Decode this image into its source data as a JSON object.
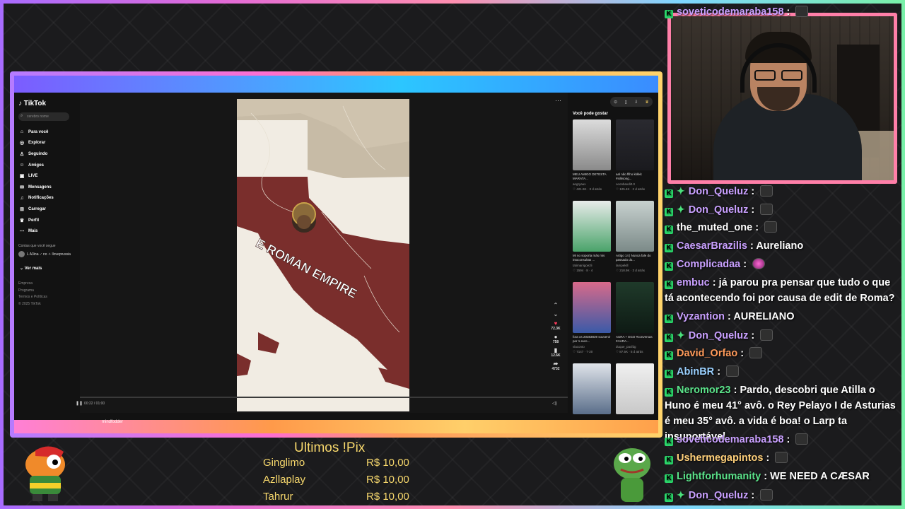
{
  "browser": {
    "tiktok": {
      "logo": "TikTok",
      "search_placeholder": "cerebro nome",
      "nav": [
        "Para você",
        "Explorar",
        "Seguindo",
        "Amigos",
        "LIVE",
        "Mensagens",
        "Notificações",
        "Carregar",
        "Perfil",
        "Mais"
      ],
      "following_title": "Contas que você segue",
      "following_user": "L A3ina ♂ no ✧ lloveprussia",
      "see_more": "Ver mais",
      "footer": [
        "Empresa",
        "Programa",
        "Termos e Políticas",
        "© 2025 TikTok"
      ],
      "video_text": "E ROMAN EMPIRE",
      "likes": "72.3K",
      "comments": "758",
      "saves": "12.6K",
      "shares": "4732",
      "time": "00:22 / 01:00",
      "bottom_user": "mindfodder",
      "suggestions_title": "Você pode gostar",
      "suggestions": [
        {
          "caption": "MEU AMIGO DETESTA MARATA...",
          "user": "angryaux",
          "meta": "♡ 421.9K · 3 d atrás"
        },
        {
          "caption": "aal não fllho kkkkk #silksong...",
          "user": "ooonbaxdi0.0",
          "meta": "♡ 125.4K · 2 d atrás"
        },
        {
          "caption": "Mi no soporta más mis intoconsultas ...",
          "user": "tatimanigoezli",
          "meta": "♡ 1594 · 8 · 4"
        },
        {
          "caption": "Artigo 14 | Nunca fale do passado do...",
          "user": "lampekill",
          "meta": "♡ 218.9K · 3 d atrás"
        },
        {
          "caption": "fora os 20383839 souvenir por 1 euro...",
          "user": "viaconto",
          "meta": "♡ 7147 · 7·20"
        },
        {
          "caption": "AURA + EGO #conversas #AURA...",
          "user": "duque_pacfdg",
          "meta": "♡ 87.5K · 5 d atrás"
        },
        {
          "caption": "",
          "user": "",
          "meta": ""
        },
        {
          "caption": "",
          "user": "",
          "meta": ""
        }
      ]
    }
  },
  "chat": [
    {
      "user": "soveticodemaraba158",
      "color": "#c9a0ff",
      "msg": "",
      "emote": true,
      "badges": [
        "k"
      ]
    },
    {
      "user": "Don_Queluz",
      "color": "#c9a0ff",
      "msg": "",
      "emote": true,
      "badges": [
        "k",
        "d"
      ]
    },
    {
      "user": "Don_Queluz",
      "color": "#c9a0ff",
      "msg": "",
      "emote": true,
      "badges": [
        "k",
        "d"
      ]
    },
    {
      "user": "the_muted_one",
      "color": "#ffffff",
      "msg": "",
      "emote": true,
      "badges": [
        "k"
      ]
    },
    {
      "user": "CaesarBrazilis",
      "color": "#c9a0ff",
      "msg": "Aureliano",
      "emote": false,
      "badges": [
        "k"
      ]
    },
    {
      "user": "Complicadaa",
      "color": "#c9a0ff",
      "msg": "",
      "emote": true,
      "emote_pink": true,
      "badges": [
        "k"
      ]
    },
    {
      "user": "embuc",
      "color": "#c9a0ff",
      "msg": "já parou pra pensar que tudo o que tá acontecendo foi por causa de edit de Roma?",
      "emote": false,
      "badges": [
        "k"
      ]
    },
    {
      "user": "Vyzantion",
      "color": "#c9a0ff",
      "msg": "AURELIANO",
      "emote": false,
      "badges": [
        "k"
      ]
    },
    {
      "user": "Don_Queluz",
      "color": "#c9a0ff",
      "msg": "",
      "emote": true,
      "badges": [
        "k",
        "d"
      ]
    },
    {
      "user": "David_Orfao",
      "color": "#ff9a5a",
      "msg": "",
      "emote": true,
      "badges": [
        "k"
      ]
    },
    {
      "user": "AbinBR",
      "color": "#9ad0ff",
      "msg": "",
      "emote": true,
      "badges": [
        "k"
      ]
    },
    {
      "user": "Neromor23",
      "color": "#5be38a",
      "msg": "Pardo, descobri que Atilla o Huno é meu 41° avô. o Rey Pelayo I de Asturias é meu 35° avô. a vida é boa! o Larp ta insuportável",
      "emote": false,
      "badges": [
        "k"
      ]
    },
    {
      "user": "soveticodemaraba158",
      "color": "#c9a0ff",
      "msg": "",
      "emote": true,
      "badges": [
        "k"
      ]
    },
    {
      "user": "Ushermegapintos",
      "color": "#ffd07a",
      "msg": "",
      "emote": true,
      "badges": [
        "k"
      ]
    },
    {
      "user": "Lightforhumanity",
      "color": "#5be38a",
      "msg": "WE NEED A CÆSAR",
      "emote": false,
      "badges": [
        "k"
      ]
    },
    {
      "user": "Don_Queluz",
      "color": "#c9a0ff",
      "msg": "",
      "emote": true,
      "badges": [
        "k",
        "d"
      ]
    }
  ],
  "pix": {
    "title": "Ultimos !Pix",
    "rows": [
      {
        "name": "Ginglimo",
        "amount": "R$ 10,00"
      },
      {
        "name": "Azllaplay",
        "amount": "R$ 10,00"
      },
      {
        "name": "Tahrur",
        "amount": "R$ 10,00"
      }
    ]
  }
}
